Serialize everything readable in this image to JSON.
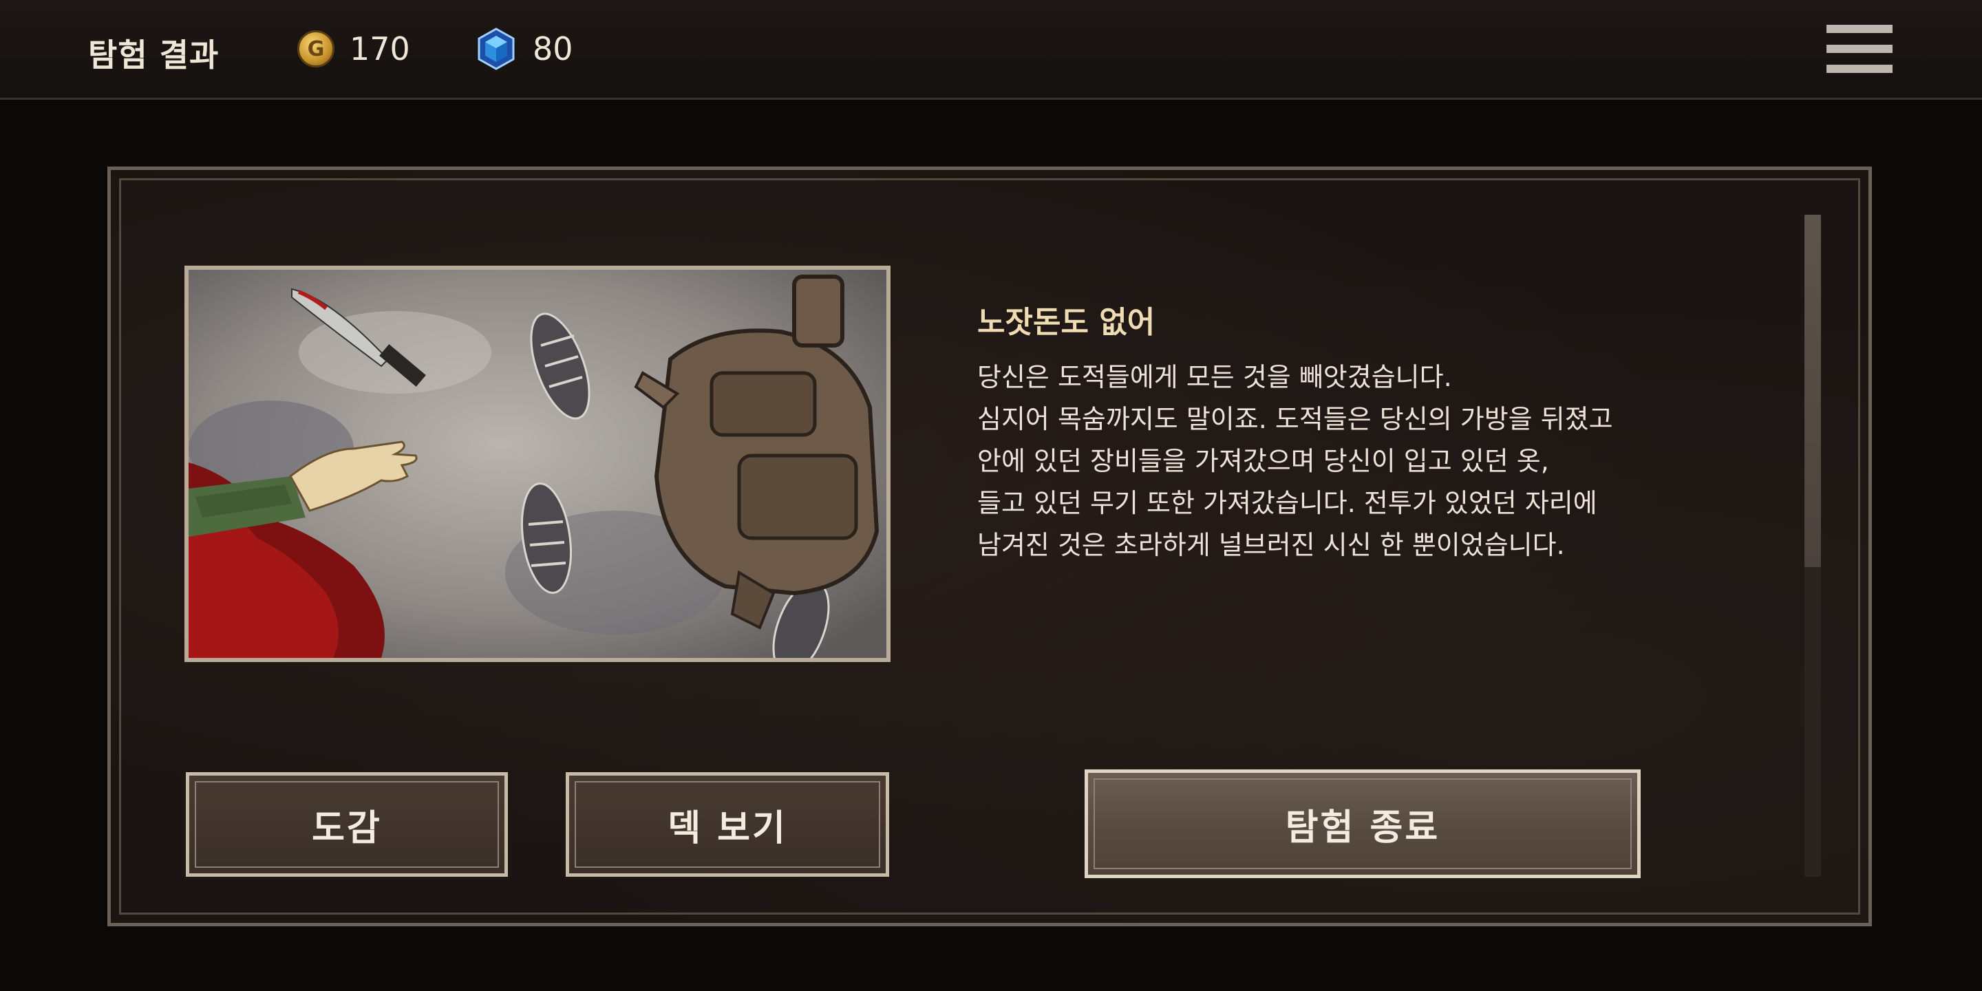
{
  "header": {
    "title": "탐험 결과",
    "gold": {
      "icon": "gold-coin-icon",
      "symbol": "G",
      "value": "170"
    },
    "gems": {
      "icon": "blue-gem-icon",
      "value": "80"
    },
    "menu_icon": "hamburger-menu-icon"
  },
  "event": {
    "title": "노잣돈도 없어",
    "lines": [
      "당신은 도적들에게 모든 것을 빼앗겼습니다.",
      "심지어 목숨까지도 말이죠. 도적들은 당신의 가방을 뒤졌고",
      "안에 있던 장비들을 가져갔으며 당신이 입고 있던 옷,",
      "들고 있던 무기 또한 가져갔습니다. 전투가 있었던 자리에",
      "남겨진 것은 초라하게 널브러진 시신 한 뿐이었습니다."
    ],
    "illustration": "bloody-knife-backpack-footprints-illustration"
  },
  "buttons": {
    "collection": "도감",
    "view_deck": "덱 보기",
    "end_expedition": "탐험 종료"
  },
  "colors": {
    "background": "#0b0908",
    "panel": "#1a1412",
    "title_accent": "#f0dcb2",
    "button_border": "#c7baa6"
  }
}
